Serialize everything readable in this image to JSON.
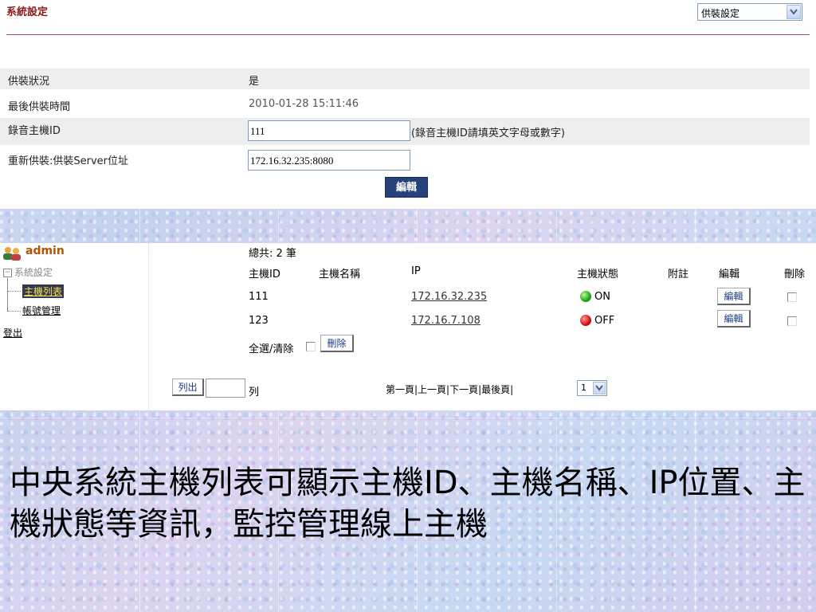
{
  "header": {
    "title": "系統設定",
    "dropdown_value": "供裝設定"
  },
  "form": {
    "rows": [
      {
        "label": "供裝狀況",
        "value": "是"
      },
      {
        "label": "最後供裝時間",
        "value": "2010-01-28 15:11:46"
      },
      {
        "label": "錄音主機ID",
        "value": "111",
        "hint": "(錄音主機ID請填英文字母或數字)"
      },
      {
        "label": "重新供裝:供裝Server位址",
        "value": "172.16.32.235:8080"
      }
    ],
    "edit_button": "編輯"
  },
  "sidebar": {
    "user": "admin",
    "root": "系統設定",
    "items": [
      {
        "label": "主機列表",
        "active": true
      },
      {
        "label": "帳號管理",
        "active": false
      }
    ],
    "logout": "登出"
  },
  "table": {
    "total": "總共: 2 筆",
    "headers": [
      "主機ID",
      "主機名稱",
      "IP",
      "主機狀態",
      "附註",
      "編輯",
      "刪除"
    ],
    "rows": [
      {
        "id": "111",
        "name": "",
        "ip": "172.16.32.235",
        "status": "ON",
        "note": "",
        "edit": "編輯"
      },
      {
        "id": "123",
        "name": "",
        "ip": "172.16.7.108",
        "status": "OFF",
        "note": "",
        "edit": "編輯"
      }
    ],
    "select_all": "全選/清除",
    "delete_button": "刪除"
  },
  "pagination": {
    "list_button": "列出",
    "list_suffix": "列",
    "links": "第一頁|上一頁|下一頁|最後頁|",
    "page": "1"
  },
  "caption": "中央系統主機列表可顯示主機ID、主機名稱、IP位置、主機狀態等資訊，監控管理線上主機",
  "colors": {
    "title_red": "#8a1a1a",
    "edit_button_bg": "#27417a",
    "on_green": "#20a020",
    "off_red": "#d01010",
    "admin_orange": "#b35200"
  }
}
